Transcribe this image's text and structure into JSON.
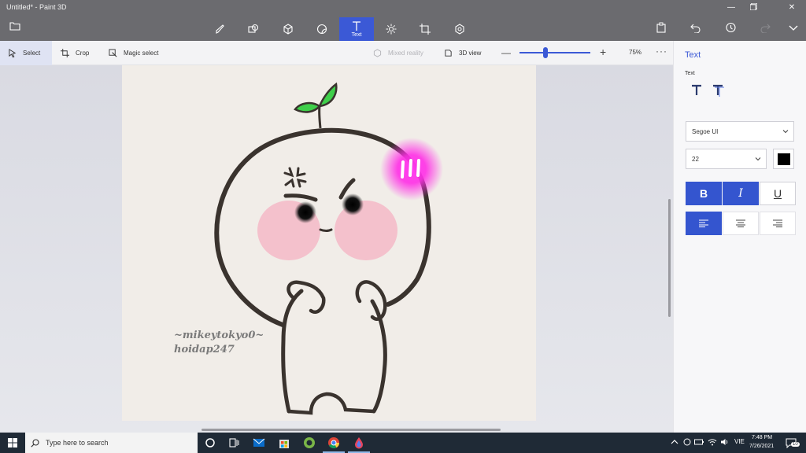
{
  "window": {
    "title": "Untitled* - Paint 3D"
  },
  "menu": {
    "tools": [
      {
        "name": "brushes",
        "label": ""
      },
      {
        "name": "2d-shapes",
        "label": ""
      },
      {
        "name": "3d-shapes",
        "label": ""
      },
      {
        "name": "stickers",
        "label": ""
      },
      {
        "name": "text",
        "label": "Text"
      },
      {
        "name": "effects",
        "label": ""
      },
      {
        "name": "canvas",
        "label": ""
      },
      {
        "name": "3d-library",
        "label": ""
      }
    ],
    "active_tool": "text"
  },
  "toolbar": {
    "select": "Select",
    "crop": "Crop",
    "magic_select": "Magic select",
    "mixed_reality": "Mixed reality",
    "view_3d": "3D view",
    "zoom_minus": "—",
    "zoom_plus": "+",
    "zoom_percent": "75%",
    "zoom_level": 0.33,
    "more": "···"
  },
  "canvas": {
    "watermark_line1": "~mikeytokyo0~",
    "watermark_line2": "hoidap247"
  },
  "panel": {
    "title": "Text",
    "subtitle": "Text",
    "font": "Segoe UI",
    "size": "22",
    "text_color": "#000000",
    "bold": "B",
    "italic": "I",
    "underline": "U",
    "bold_active": true,
    "italic_active": true,
    "underline_active": false,
    "alignment": "left"
  },
  "taskbar": {
    "search_placeholder": "Type here to search",
    "language": "VIE",
    "time": "7:48 PM",
    "date": "7/26/2021",
    "notification_count": "10"
  },
  "colors": {
    "accent": "#3b59d6",
    "title_bar": "#6b6b6f",
    "taskbar": "#1f2a36"
  }
}
